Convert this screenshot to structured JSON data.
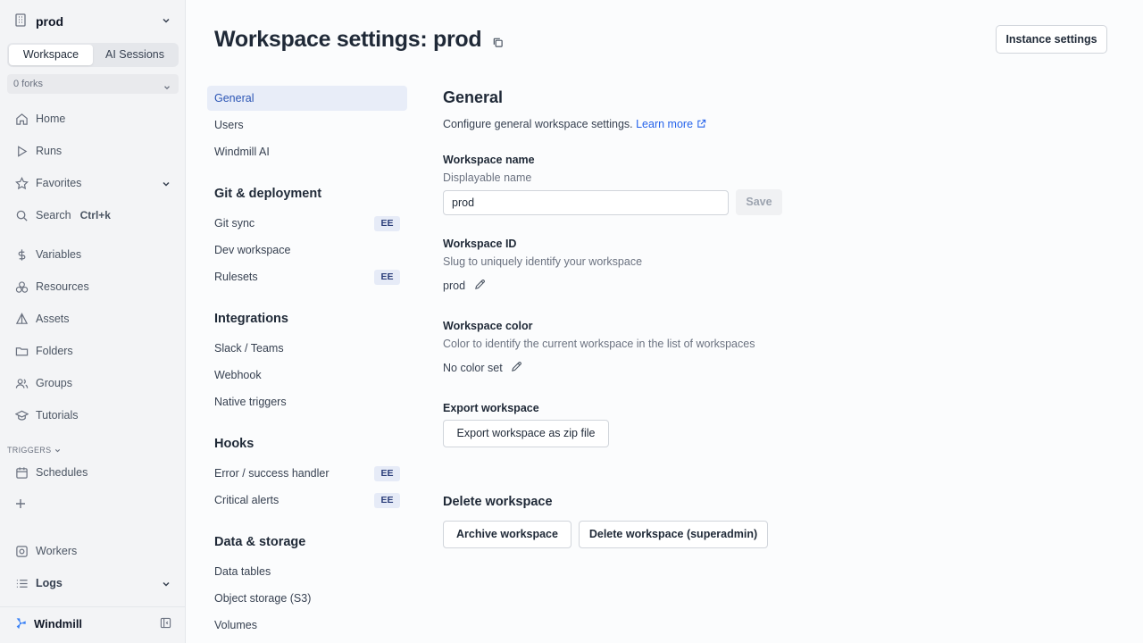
{
  "sidebar": {
    "workspace": "prod",
    "tabs": [
      "Workspace",
      "AI Sessions"
    ],
    "forks": "0 forks",
    "items": [
      {
        "label": "Home",
        "icon": "home-icon"
      },
      {
        "label": "Runs",
        "icon": "play-icon"
      },
      {
        "label": "Favorites",
        "icon": "star-icon"
      },
      {
        "label": "Search",
        "icon": "search-icon",
        "shortcut": "Ctrl+k"
      },
      {
        "label": "Variables",
        "icon": "dollar-icon"
      },
      {
        "label": "Resources",
        "icon": "boxes-icon"
      },
      {
        "label": "Assets",
        "icon": "pyramid-icon"
      },
      {
        "label": "Folders",
        "icon": "folder-icon"
      },
      {
        "label": "Groups",
        "icon": "users-icon"
      },
      {
        "label": "Tutorials",
        "icon": "graduation-cap-icon"
      }
    ],
    "triggers_label": "TRIGGERS",
    "schedules": "Schedules",
    "workers": "Workers",
    "logs": "Logs",
    "brand": "Windmill"
  },
  "header": {
    "title": "Workspace settings: prod",
    "instance_button": "Instance settings"
  },
  "settings_nav": {
    "general": "General",
    "users": "Users",
    "windmill_ai": "Windmill AI",
    "git_head": "Git & deployment",
    "git_sync": "Git sync",
    "dev_workspace": "Dev workspace",
    "rulesets": "Rulesets",
    "integrations_head": "Integrations",
    "slack": "Slack / Teams",
    "webhook": "Webhook",
    "native_triggers": "Native triggers",
    "hooks_head": "Hooks",
    "error_handler": "Error / success handler",
    "critical_alerts": "Critical alerts",
    "data_head": "Data & storage",
    "data_tables": "Data tables",
    "object_storage": "Object storage (S3)",
    "volumes": "Volumes",
    "ee_badge": "EE"
  },
  "general": {
    "title": "General",
    "description": "Configure general workspace settings.",
    "learn_more": "Learn more",
    "name_label": "Workspace name",
    "name_sub": "Displayable name",
    "name_value": "prod",
    "save": "Save",
    "id_label": "Workspace ID",
    "id_sub": "Slug to uniquely identify your workspace",
    "id_value": "prod",
    "color_label": "Workspace color",
    "color_sub": "Color to identify the current workspace in the list of workspaces",
    "color_value": "No color set",
    "export_label": "Export workspace",
    "export_button": "Export workspace as zip file",
    "delete_title": "Delete workspace",
    "archive_button": "Archive workspace",
    "delete_button": "Delete workspace (superadmin)"
  },
  "colors": {
    "accent": "#2b55b5",
    "link": "#2563eb",
    "active_bg": "#e8edf8"
  }
}
